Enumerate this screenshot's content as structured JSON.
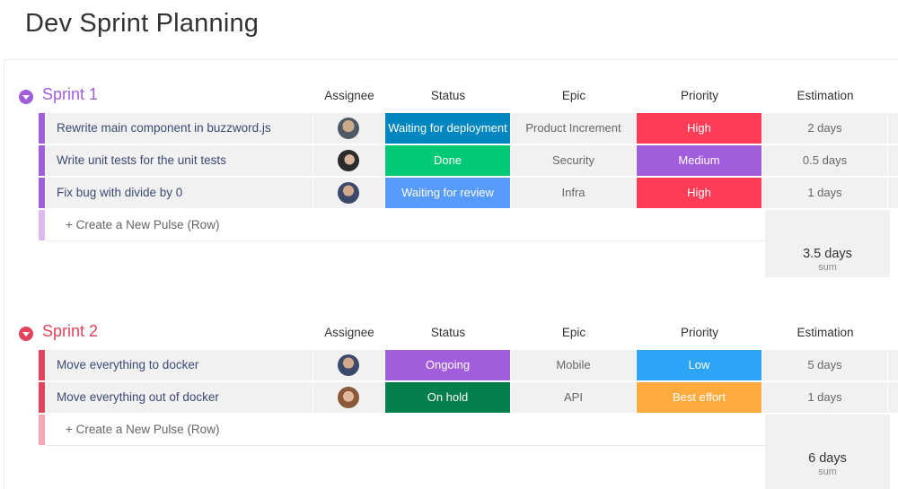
{
  "page": {
    "title": "Dev Sprint Planning"
  },
  "columns": [
    "Assignee",
    "Status",
    "Epic",
    "Priority",
    "Estimation"
  ],
  "groups": [
    {
      "title": "Sprint 1",
      "color": "#a25ddc",
      "light_color": "#dcbbf1",
      "rows": [
        {
          "name": "Rewrite main component in buzzword.js",
          "avatar_icon": "user-avatar-icon",
          "status": {
            "label": "Waiting for deployment",
            "color": "#0086c0"
          },
          "epic": "Product Increment",
          "priority": {
            "label": "High",
            "color": "#ff3d57"
          },
          "estimation": "2 days"
        },
        {
          "name": "Write unit tests for the unit tests",
          "avatar_icon": "user-avatar-icon",
          "status": {
            "label": "Done",
            "color": "#00c875"
          },
          "epic": "Security",
          "priority": {
            "label": "Medium",
            "color": "#a25ddc"
          },
          "estimation": "0.5 days"
        },
        {
          "name": "Fix bug with divide by 0",
          "avatar_icon": "user-avatar-icon",
          "status": {
            "label": "Waiting for review",
            "color": "#579bfc"
          },
          "epic": "Infra",
          "priority": {
            "label": "High",
            "color": "#ff3d57"
          },
          "estimation": "1 days"
        }
      ],
      "create_label": "+ Create a New Pulse (Row)",
      "sum": {
        "value": "3.5 days",
        "label": "sum"
      }
    },
    {
      "title": "Sprint 2",
      "color": "#e2445c",
      "light_color": "#f7a7b3",
      "rows": [
        {
          "name": "Move everything to docker",
          "avatar_icon": "user-avatar-icon",
          "status": {
            "label": "Ongoing",
            "color": "#a25ddc"
          },
          "epic": "Mobile",
          "priority": {
            "label": "Low",
            "color": "#2da4f6"
          },
          "estimation": "5 days"
        },
        {
          "name": "Move everything out of docker",
          "avatar_icon": "user-avatar-icon",
          "status": {
            "label": "On hold",
            "color": "#037f4c"
          },
          "epic": "API",
          "priority": {
            "label": "Best effort",
            "color": "#fdab3d"
          },
          "estimation": "1 days"
        }
      ],
      "create_label": "+ Create a New Pulse (Row)",
      "sum": {
        "value": "6 days",
        "label": "sum"
      }
    }
  ]
}
